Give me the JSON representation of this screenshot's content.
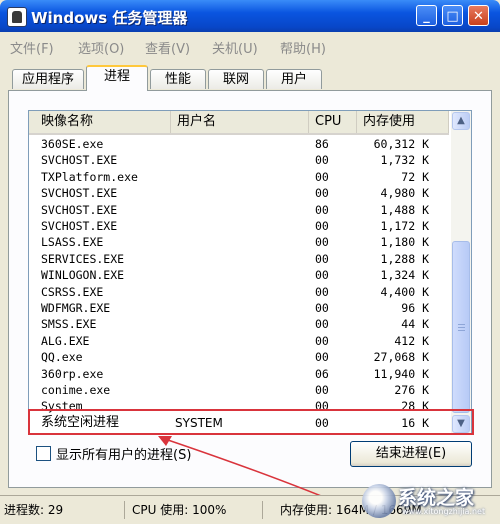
{
  "window": {
    "title": "Windows 任务管理器",
    "buttons": {
      "minimize": "_",
      "maximize": "□",
      "close": "✕"
    }
  },
  "menu": [
    "文件(F)",
    "选项(O)",
    "查看(V)",
    "关机(U)",
    "帮助(H)"
  ],
  "tabs": [
    {
      "label": "应用程序",
      "active": false
    },
    {
      "label": "进程",
      "active": true
    },
    {
      "label": "性能",
      "active": false
    },
    {
      "label": "联网",
      "active": false
    },
    {
      "label": "用户",
      "active": false
    }
  ],
  "columns": {
    "name": "映像名称",
    "user": "用户名",
    "cpu": "CPU",
    "mem": "内存使用"
  },
  "processes": [
    {
      "name": "360SE.exe",
      "user": "",
      "cpu": "86",
      "mem": "60,312 K"
    },
    {
      "name": "SVCHOST.EXE",
      "user": "",
      "cpu": "00",
      "mem": "1,732 K"
    },
    {
      "name": "TXPlatform.exe",
      "user": "",
      "cpu": "00",
      "mem": "72 K"
    },
    {
      "name": "SVCHOST.EXE",
      "user": "",
      "cpu": "00",
      "mem": "4,980 K"
    },
    {
      "name": "SVCHOST.EXE",
      "user": "",
      "cpu": "00",
      "mem": "1,488 K"
    },
    {
      "name": "SVCHOST.EXE",
      "user": "",
      "cpu": "00",
      "mem": "1,172 K"
    },
    {
      "name": "LSASS.EXE",
      "user": "",
      "cpu": "00",
      "mem": "1,180 K"
    },
    {
      "name": "SERVICES.EXE",
      "user": "",
      "cpu": "00",
      "mem": "1,288 K"
    },
    {
      "name": "WINLOGON.EXE",
      "user": "",
      "cpu": "00",
      "mem": "1,324 K"
    },
    {
      "name": "CSRSS.EXE",
      "user": "",
      "cpu": "00",
      "mem": "4,400 K"
    },
    {
      "name": "WDFMGR.EXE",
      "user": "",
      "cpu": "00",
      "mem": "96 K"
    },
    {
      "name": "SMSS.EXE",
      "user": "",
      "cpu": "00",
      "mem": "44 K"
    },
    {
      "name": "ALG.EXE",
      "user": "",
      "cpu": "00",
      "mem": "412 K"
    },
    {
      "name": "QQ.exe",
      "user": "",
      "cpu": "00",
      "mem": "27,068 K"
    },
    {
      "name": "360rp.exe",
      "user": "",
      "cpu": "06",
      "mem": "11,940 K"
    },
    {
      "name": "conime.exe",
      "user": "",
      "cpu": "00",
      "mem": "276 K"
    },
    {
      "name": "System",
      "user": "",
      "cpu": "00",
      "mem": "28 K"
    },
    {
      "name": "系统空闲进程",
      "user": "SYSTEM",
      "cpu": "00",
      "mem": "16 K",
      "selected": true
    }
  ],
  "show_all_users": {
    "label": "显示所有用户的进程(S)",
    "checked": false
  },
  "end_process_label": "结束进程(E)",
  "status": {
    "process_count": "进程数: 29",
    "cpu_usage": "CPU 使用: 100%",
    "memory": "内存使用: 164M / 1669M"
  },
  "watermark": {
    "name": "系统之家",
    "url": "www.xitongzhijia.net"
  },
  "colors": {
    "title_bar": "#0a55e0",
    "highlight_annotation": "#d9343c",
    "window_bg": "#ece9d8"
  },
  "icons": [
    "app-icon",
    "minimize-icon",
    "maximize-icon",
    "close-icon",
    "scroll-up-icon",
    "scroll-down-icon"
  ]
}
